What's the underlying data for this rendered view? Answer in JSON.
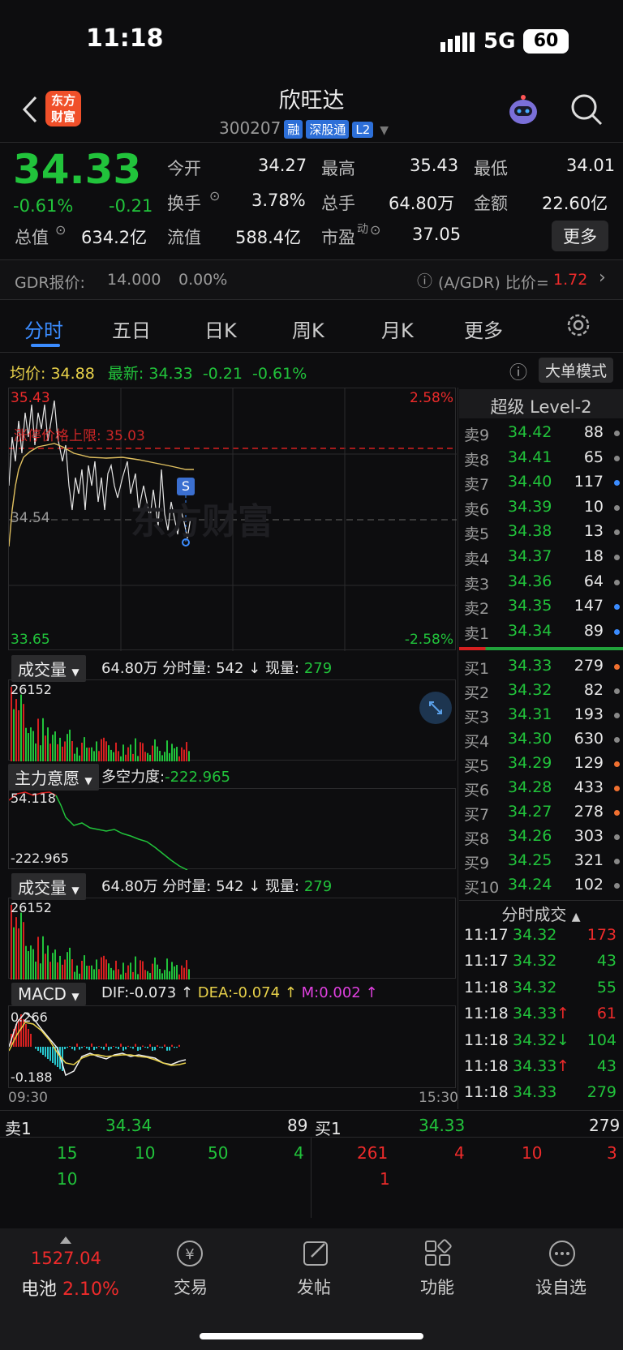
{
  "status": {
    "time": "11:18",
    "network": "5G",
    "battery": "60"
  },
  "header": {
    "title": "欣旺达",
    "code": "300207",
    "tags": [
      "融",
      "深股通",
      "L2"
    ],
    "logo": "东方财富"
  },
  "quote": {
    "price": "34.33",
    "pct": "-0.61%",
    "chg": "-0.21",
    "fields": [
      {
        "label": "今开",
        "value": "34.27",
        "color": "g"
      },
      {
        "label": "最高",
        "value": "35.43",
        "color": "r"
      },
      {
        "label": "最低",
        "value": "34.01",
        "color": "g"
      },
      {
        "label": "换手",
        "value": "3.78%",
        "color": "w"
      },
      {
        "label": "总手",
        "value": "64.80万",
        "color": "w"
      },
      {
        "label": "金额",
        "value": "22.60亿",
        "color": "w"
      },
      {
        "label": "总值",
        "value": "634.2亿",
        "color": "w"
      },
      {
        "label": "流值",
        "value": "588.4亿",
        "color": "w"
      },
      {
        "label": "市盈",
        "value": "37.05",
        "color": "w"
      }
    ],
    "pe_sup": "动",
    "more": "更多"
  },
  "gdr": {
    "label": "GDR报价:",
    "price": "14.000",
    "pct": "0.00%",
    "ratio_label": "(A/GDR) 比价=",
    "ratio": "1.72"
  },
  "tabs": [
    "分时",
    "五日",
    "日K",
    "周K",
    "月K",
    "更多"
  ],
  "avgbar": {
    "avg_label": "均价:",
    "avg": "34.88",
    "latest_label": "最新:",
    "latest": "34.33",
    "chg": "-0.21",
    "pct": "-0.61%",
    "mode": "大单模式"
  },
  "chart": {
    "top": "35.43",
    "top_pct": "2.58%",
    "mid": "34.54",
    "bottom": "33.65",
    "bottom_pct": "-2.58%",
    "limit_label": "涨停价格上限: 35.03",
    "s_mark": "S",
    "watermark": "东方财富",
    "time_start": "09:30",
    "time_end": "15:30"
  },
  "vol": {
    "title": "成交量",
    "total": "64.80万",
    "minute_label": "分时量:",
    "minute": "542",
    "arrow": "↓",
    "now_label": "现量:",
    "now": "279",
    "max": "26152"
  },
  "force": {
    "title": "主力意愿",
    "label": "多空力度:",
    "value": "-222.965",
    "max": "54.118",
    "min": "-222.965"
  },
  "macd": {
    "title": "MACD",
    "dif": "DIF:-0.073 ↑",
    "dea": "DEA:-0.074 ↑",
    "m": "M:0.002 ↑",
    "max": "0.266",
    "min": "-0.188"
  },
  "orderbook": {
    "title": "超级 Level-2",
    "sells": [
      {
        "label": "卖9",
        "price": "34.42",
        "vol": "88",
        "dot": "#888"
      },
      {
        "label": "卖8",
        "price": "34.41",
        "vol": "65",
        "dot": "#888"
      },
      {
        "label": "卖7",
        "price": "34.40",
        "vol": "117",
        "dot": "#3b8cff"
      },
      {
        "label": "卖6",
        "price": "34.39",
        "vol": "10",
        "dot": "#888"
      },
      {
        "label": "卖5",
        "price": "34.38",
        "vol": "13",
        "dot": "#888"
      },
      {
        "label": "卖4",
        "price": "34.37",
        "vol": "18",
        "dot": "#888"
      },
      {
        "label": "卖3",
        "price": "34.36",
        "vol": "64",
        "dot": "#888"
      },
      {
        "label": "卖2",
        "price": "34.35",
        "vol": "147",
        "dot": "#3b8cff"
      },
      {
        "label": "卖1",
        "price": "34.34",
        "vol": "89",
        "dot": "#3b8cff"
      }
    ],
    "buys": [
      {
        "label": "买1",
        "price": "34.33",
        "vol": "279",
        "dot": "#f07030"
      },
      {
        "label": "买2",
        "price": "34.32",
        "vol": "82",
        "dot": "#888"
      },
      {
        "label": "买3",
        "price": "34.31",
        "vol": "193",
        "dot": "#888"
      },
      {
        "label": "买4",
        "price": "34.30",
        "vol": "630",
        "dot": "#888"
      },
      {
        "label": "买5",
        "price": "34.29",
        "vol": "129",
        "dot": "#f07030"
      },
      {
        "label": "买6",
        "price": "34.28",
        "vol": "433",
        "dot": "#f07030"
      },
      {
        "label": "买7",
        "price": "34.27",
        "vol": "278",
        "dot": "#f07030"
      },
      {
        "label": "买8",
        "price": "34.26",
        "vol": "303",
        "dot": "#888"
      },
      {
        "label": "买9",
        "price": "34.25",
        "vol": "321",
        "dot": "#888"
      },
      {
        "label": "买10",
        "price": "34.24",
        "vol": "102",
        "dot": "#888"
      }
    ]
  },
  "ticks": {
    "title": "分时成交",
    "rows": [
      {
        "time": "11:17",
        "price": "34.32",
        "arrow": "",
        "vol": "173",
        "vc": "r"
      },
      {
        "time": "11:17",
        "price": "34.32",
        "arrow": "",
        "vol": "43",
        "vc": "g"
      },
      {
        "time": "11:18",
        "price": "34.32",
        "arrow": "",
        "vol": "55",
        "vc": "g"
      },
      {
        "time": "11:18",
        "price": "34.33",
        "arrow": "↑",
        "vol": "61",
        "vc": "r"
      },
      {
        "time": "11:18",
        "price": "34.32",
        "arrow": "↓",
        "vol": "104",
        "vc": "g"
      },
      {
        "time": "11:18",
        "price": "34.33",
        "arrow": "↑",
        "vol": "43",
        "vc": "g"
      },
      {
        "time": "11:18",
        "price": "34.33",
        "arrow": "",
        "vol": "279",
        "vc": "g"
      }
    ]
  },
  "bottom_book": {
    "sell_label": "卖1",
    "sell_price": "34.34",
    "sell_vol": "89",
    "buy_label": "买1",
    "buy_price": "34.33",
    "buy_vol": "279",
    "sell_q1": [
      "15",
      "10",
      "50",
      "4"
    ],
    "sell_q2": [
      "10"
    ],
    "buy_q1": [
      "261",
      "4",
      "10",
      "3"
    ],
    "buy_q2": [
      "1"
    ]
  },
  "nav": {
    "index": "1527.04",
    "index_name": "电池",
    "index_pct": "2.10%",
    "items": [
      "交易",
      "发帖",
      "功能",
      "设自选"
    ]
  }
}
